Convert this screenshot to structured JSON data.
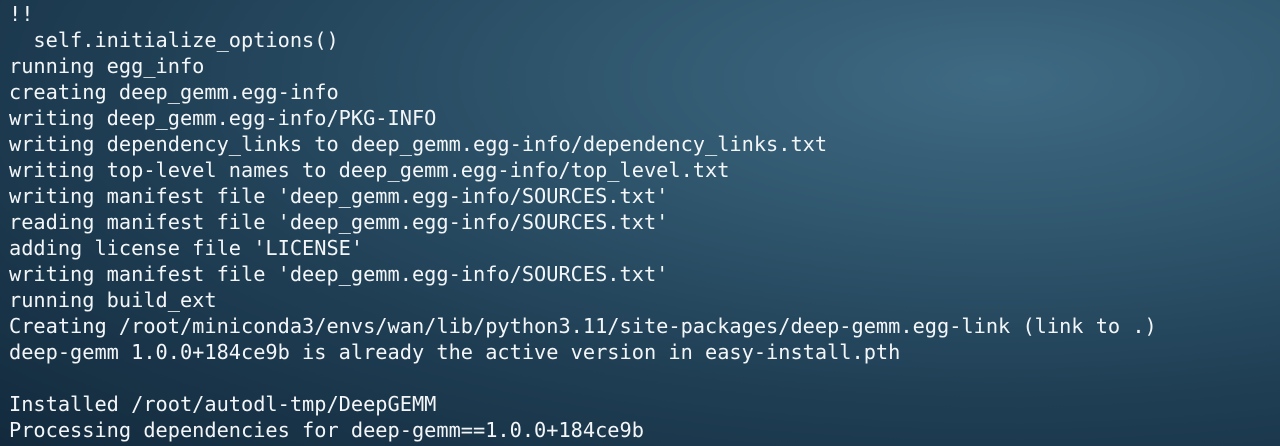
{
  "terminal": {
    "lines": [
      "!!",
      "  self.initialize_options()",
      "running egg_info",
      "creating deep_gemm.egg-info",
      "writing deep_gemm.egg-info/PKG-INFO",
      "writing dependency_links to deep_gemm.egg-info/dependency_links.txt",
      "writing top-level names to deep_gemm.egg-info/top_level.txt",
      "writing manifest file 'deep_gemm.egg-info/SOURCES.txt'",
      "reading manifest file 'deep_gemm.egg-info/SOURCES.txt'",
      "adding license file 'LICENSE'",
      "writing manifest file 'deep_gemm.egg-info/SOURCES.txt'",
      "running build_ext",
      "Creating /root/miniconda3/envs/wan/lib/python3.11/site-packages/deep-gemm.egg-link (link to .)",
      "deep-gemm 1.0.0+184ce9b is already the active version in easy-install.pth",
      "",
      "Installed /root/autodl-tmp/DeepGEMM",
      "Processing dependencies for deep-gemm==1.0.0+184ce9b"
    ]
  }
}
